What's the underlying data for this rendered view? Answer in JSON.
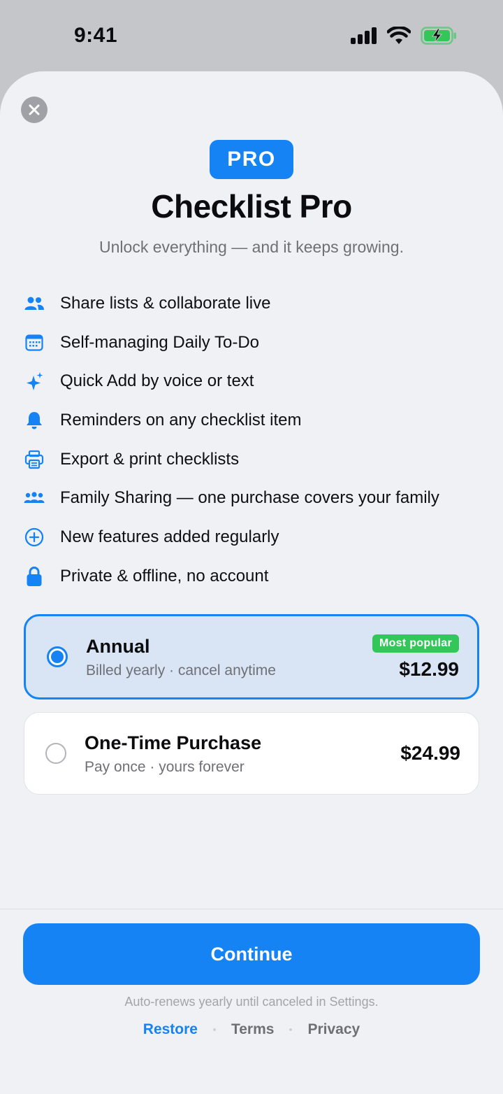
{
  "status_bar": {
    "time": "9:41",
    "icons": [
      "cellular-signal-icon",
      "wifi-icon",
      "battery-charging-icon"
    ],
    "battery_color": "#33c759"
  },
  "sheet": {
    "close_icon": "close-icon",
    "badge": "PRO",
    "title": "Checklist Pro",
    "subtitle": "Unlock everything — and it keeps growing.",
    "features": [
      {
        "icon": "people-icon",
        "label": "Share lists & collaborate live"
      },
      {
        "icon": "calendar-icon",
        "label": "Self-managing Daily To-Do"
      },
      {
        "icon": "sparkles-icon",
        "label": "Quick Add by voice or text"
      },
      {
        "icon": "bell-icon",
        "label": "Reminders on any checklist item"
      },
      {
        "icon": "printer-icon",
        "label": "Export & print checklists"
      },
      {
        "icon": "family-icon",
        "label": "Family Sharing — one purchase covers your family"
      },
      {
        "icon": "plus-circle-icon",
        "label": "New features added regularly"
      },
      {
        "icon": "lock-icon",
        "label": "Private & offline, no account"
      }
    ],
    "plans": {
      "annual": {
        "name": "Annual",
        "description": "Billed yearly · cancel anytime",
        "badge": "Most popular",
        "price": "$12.99",
        "selected": true
      },
      "one_time": {
        "name": "One-Time Purchase",
        "description": "Pay once · yours forever",
        "price": "$24.99",
        "selected": false
      }
    },
    "continue_label": "Continue",
    "renew_note": "Auto-renews yearly until canceled in Settings.",
    "links": {
      "restore": "Restore",
      "terms": "Terms",
      "privacy": "Privacy"
    }
  },
  "colors": {
    "accent": "#1683f5",
    "badge_green": "#33c759",
    "sheet_background": "#f0f1f5",
    "selected_plan_background": "#d9e5f4"
  }
}
